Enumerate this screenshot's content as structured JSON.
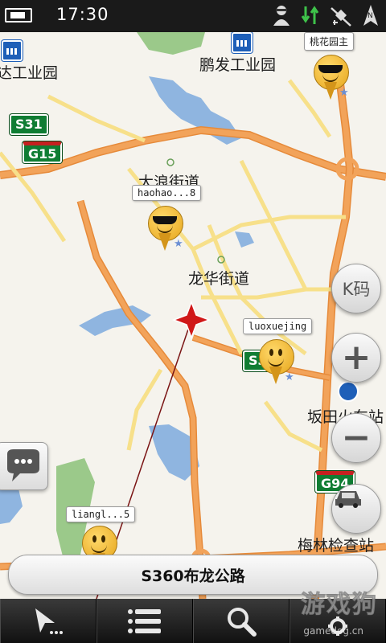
{
  "status_bar": {
    "time": "17:30",
    "icons": [
      "battery-icon",
      "profile-icon",
      "data-sync-icon",
      "gps-off-icon",
      "signal-icon"
    ]
  },
  "map": {
    "place_labels": {
      "industrial_park_left": "达工业园",
      "pengfa_industrial_park": "鹏发工业园",
      "dalang_subdistrict": "大浪街道",
      "longhua_subdistrict": "龙华街道",
      "bantian_station": "坂田火车站",
      "meilin_checkpoint": "梅林检查站"
    },
    "road_shields": {
      "s31": "S31",
      "g15": "G15",
      "s3_partial": "S3",
      "g94": "G94"
    },
    "user_bubbles": {
      "taohuayuan": "桃花园主",
      "haohao": "haohao...8",
      "luoxuejing": "luoxuejing",
      "liangl": "liangl...5"
    },
    "scale": "2km",
    "colors": {
      "road_orange": "#f2a35a",
      "road_yellow": "#f7e08a",
      "water": "#8fb5e0",
      "park": "#9bc98a"
    }
  },
  "controls": {
    "k_code_label": "K码",
    "zoom_in": "+",
    "zoom_out": "−"
  },
  "current_road": "S360布龙公路",
  "toolbar": {
    "buttons": [
      "navigate-icon",
      "menu-list-icon",
      "search-icon",
      "settings-icon"
    ]
  },
  "watermark": {
    "brand": "游戏狗",
    "site": "gamedog.cn"
  }
}
